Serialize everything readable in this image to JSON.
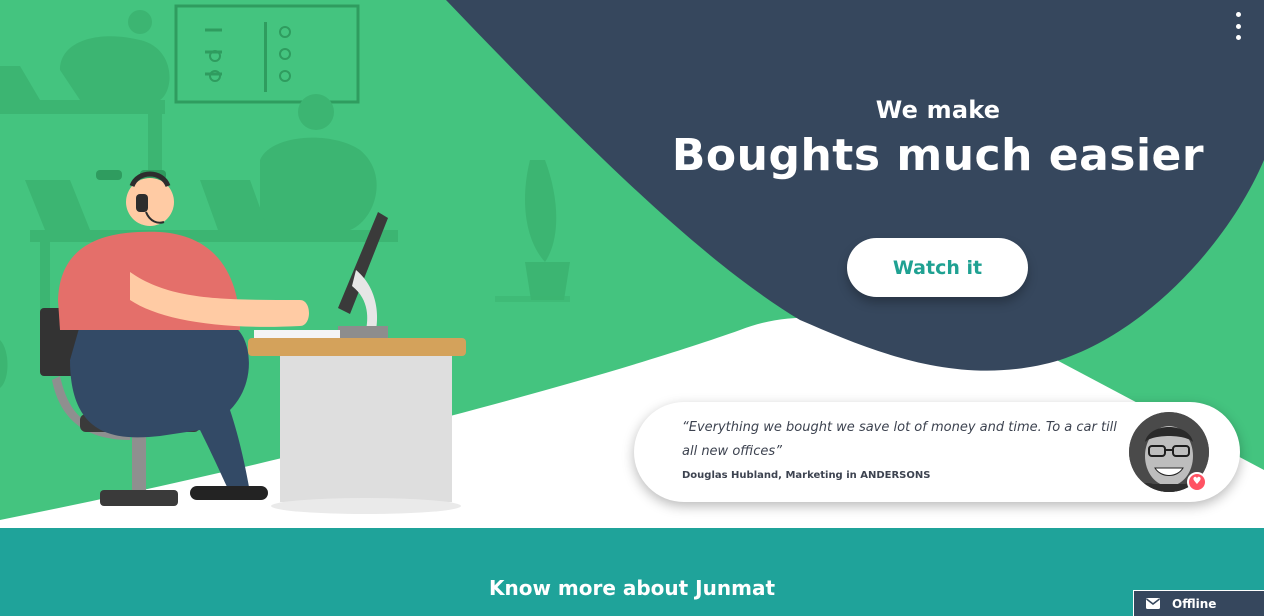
{
  "hero": {
    "kicker": "We make",
    "headline": "Boughts much easier",
    "cta_label": "Watch it"
  },
  "testimonial": {
    "quote": "“Everything we bought we save lot of money and time. To a car till all new offices”",
    "author": "Douglas Hubland, Marketing in ANDERSONS"
  },
  "section": {
    "title": "Know more about Junmat"
  },
  "chat": {
    "status": "Offline"
  },
  "colors": {
    "hero_green": "#44c47f",
    "navy": "#36475d",
    "teal": "#1fa39a",
    "accent_text": "#1fa192",
    "heart": "#ff5363"
  }
}
